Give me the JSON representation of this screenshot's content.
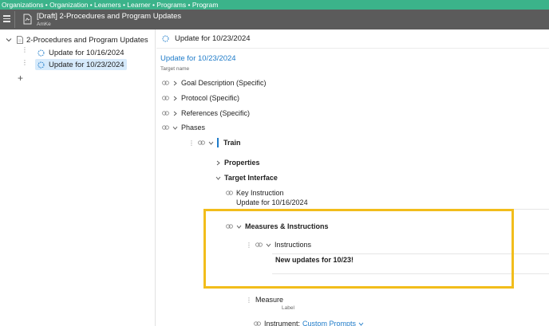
{
  "breadcrumb": "Organizations • Organization • Learners • Learner • Programs • Program",
  "titlebar": {
    "title": "[Draft] 2-Procedures and Program Updates",
    "subtitle": "AmKe"
  },
  "sidebar": {
    "root": "2-Procedures and Program Updates",
    "items": [
      {
        "label": "Update for 10/16/2024",
        "selected": false
      },
      {
        "label": "Update for 10/23/2024",
        "selected": true
      }
    ],
    "add_label": "+"
  },
  "main": {
    "header": "Update for 10/23/2024",
    "target_name_value": "Update for 10/23/2024",
    "target_name_label": "Target name",
    "sections": [
      "Goal Description (Specific)",
      "Protocol (Specific)",
      "References (Specific)",
      "Phases"
    ],
    "phase": "Train",
    "properties": "Properties",
    "target_interface": "Target Interface",
    "key_instruction_label": "Key Instruction",
    "key_instruction_value": "Update for 10/16/2024",
    "measures_instructions": "Measures & Instructions",
    "instructions_label": "Instructions",
    "instructions_text": "New updates for 10/23!",
    "measure_value": "Measure",
    "measure_label": "Label",
    "instrument_label": "Instrument:",
    "instrument_value": "Custom Prompts"
  },
  "colors": {
    "crumb_bg": "#3bb38a",
    "titlebar_bg": "#5b5b5b",
    "accent": "#1e7bc9",
    "highlight": "#f2bd1b",
    "selection": "#d6eafb"
  }
}
